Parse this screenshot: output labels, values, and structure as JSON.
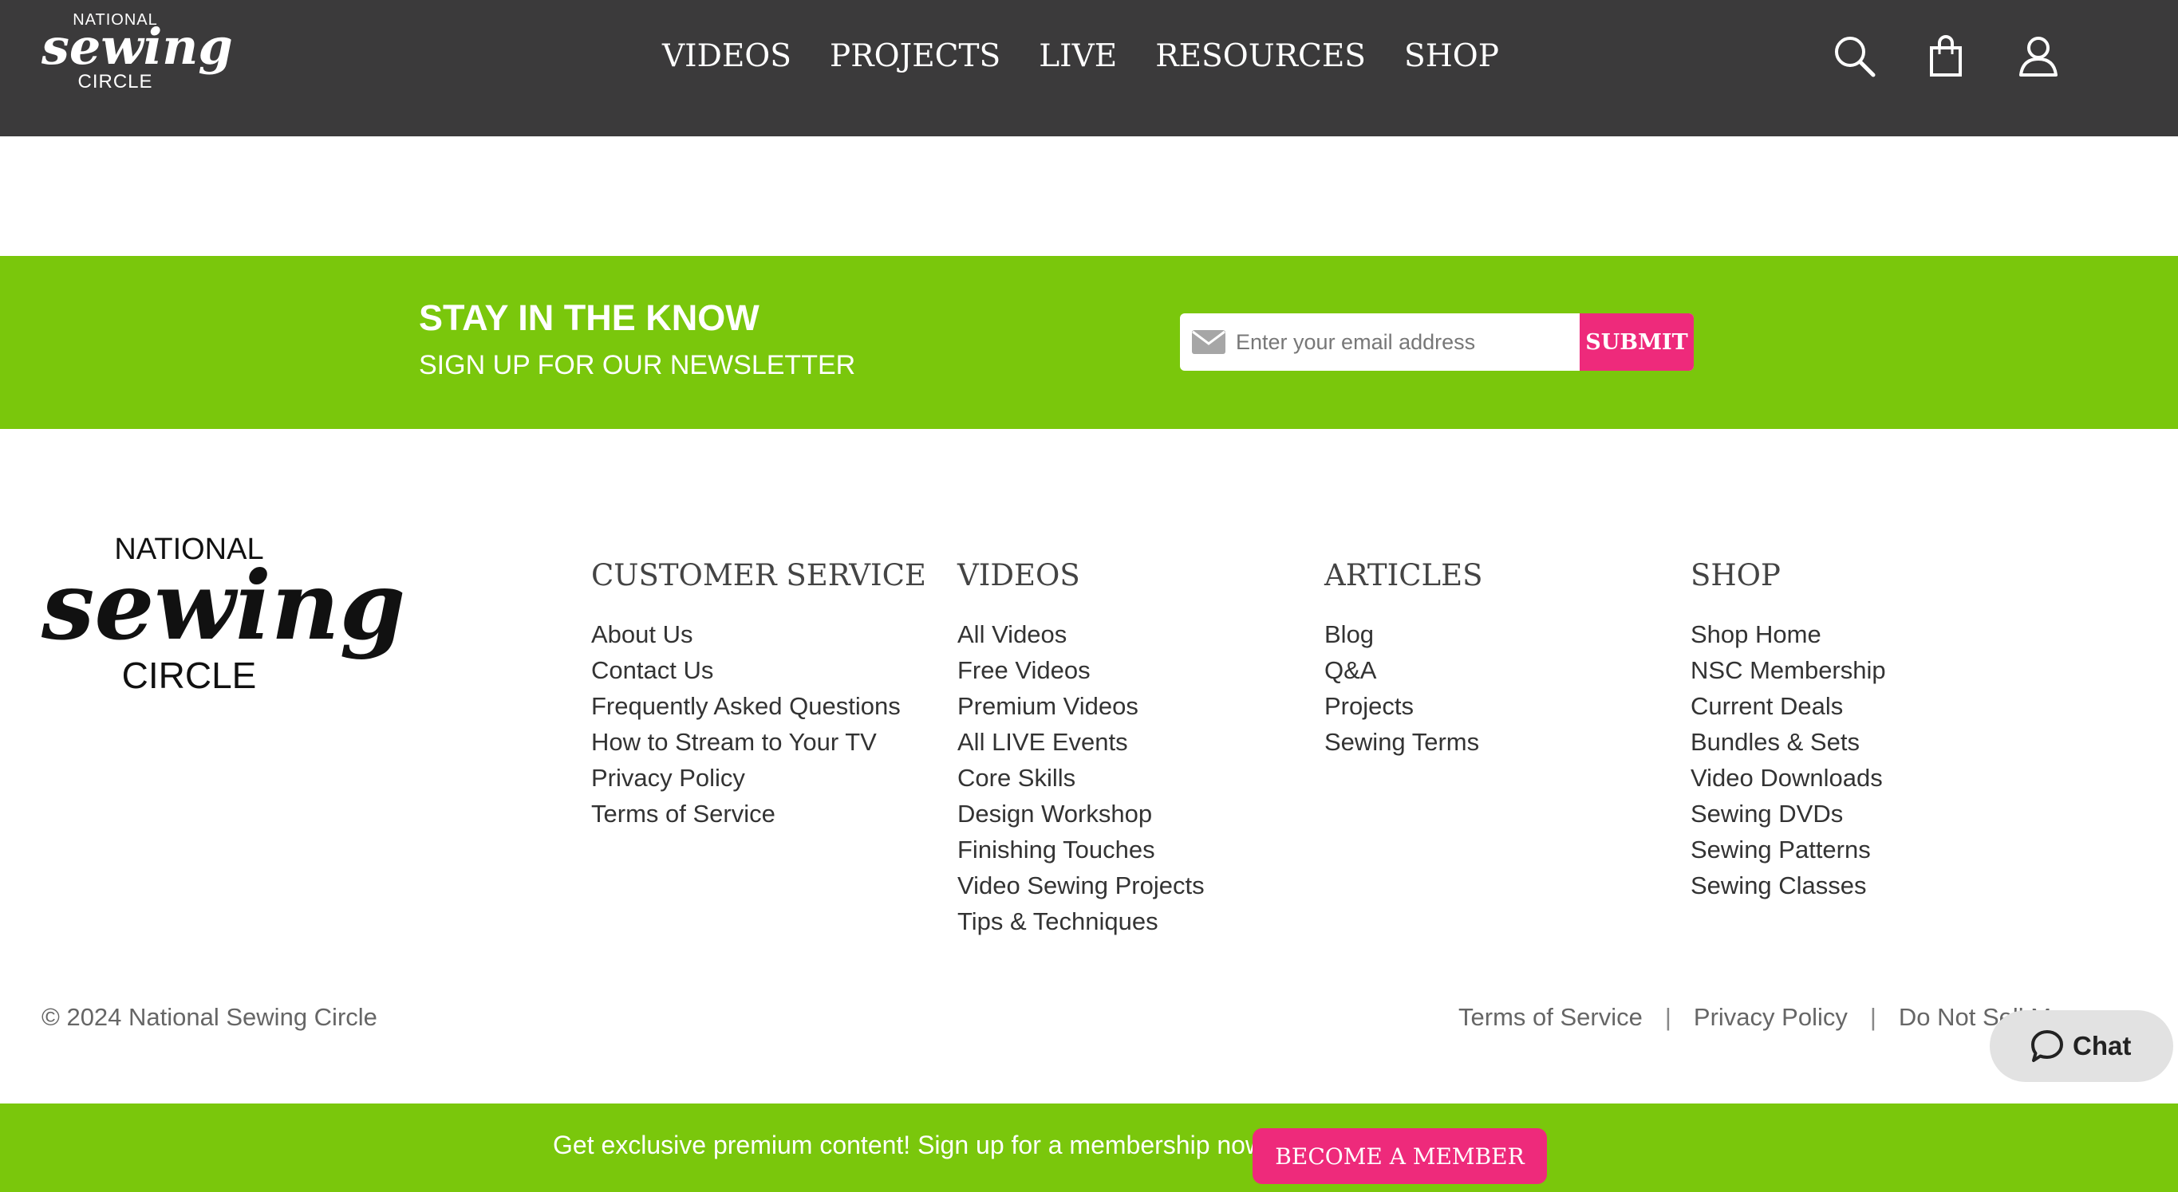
{
  "header": {
    "logo": {
      "line1": "NATIONAL",
      "line2": "sewing",
      "line3": "CIRCLE"
    },
    "nav": [
      "VIDEOS",
      "PROJECTS",
      "LIVE",
      "RESOURCES",
      "SHOP"
    ],
    "icons": [
      "search-icon",
      "shopping-bag-icon",
      "user-icon"
    ],
    "background": "#3b3a3b"
  },
  "newsletter": {
    "title": "STAY IN THE KNOW",
    "subtitle": "SIGN UP FOR OUR NEWSLETTER",
    "email_placeholder": "Enter your email address",
    "submit_label": "SUBMIT",
    "background": "#7ac70c"
  },
  "footer": {
    "logo": {
      "line1": "NATIONAL",
      "line2": "sewing",
      "line3": "CIRCLE"
    },
    "columns": [
      {
        "heading": "CUSTOMER SERVICE",
        "links": [
          "About Us",
          "Contact Us",
          "Frequently Asked Questions",
          "How to Stream to Your TV",
          "Privacy Policy",
          "Terms of Service"
        ]
      },
      {
        "heading": "VIDEOS",
        "links": [
          "All Videos",
          "Free Videos",
          "Premium Videos",
          "All LIVE Events",
          "Core Skills",
          "Design Workshop",
          "Finishing Touches",
          "Video Sewing Projects",
          "Tips & Techniques"
        ]
      },
      {
        "heading": "ARTICLES",
        "links": [
          "Blog",
          "Q&A",
          "Projects",
          "Sewing Terms"
        ]
      },
      {
        "heading": "SHOP",
        "links": [
          "Shop Home",
          "NSC Membership",
          "Current Deals",
          "Bundles & Sets",
          "Video Downloads",
          "Sewing DVDs",
          "Sewing Patterns",
          "Sewing Classes"
        ]
      }
    ],
    "copyright": "© 2024 National Sewing Circle",
    "legal": {
      "terms": "Terms of Service",
      "separator": "|",
      "privacy": "Privacy Policy",
      "do_not_sell": "Do Not Sell M"
    }
  },
  "chat": {
    "label": "Chat",
    "icon": "chat-bubble-icon"
  },
  "membership_bar": {
    "text": "Get exclusive premium content! Sign up for a membership now!",
    "button_label": "BECOME A MEMBER"
  },
  "colors": {
    "accent_pink": "#ee2a7b",
    "green": "#7ac70c"
  }
}
